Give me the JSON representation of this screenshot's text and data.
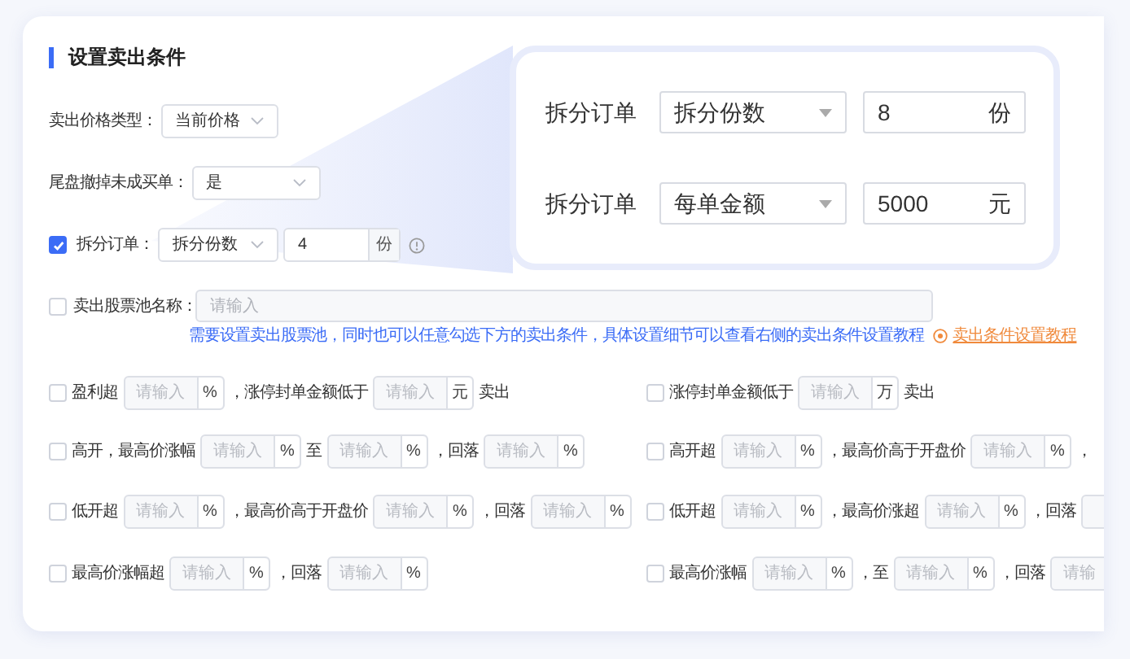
{
  "title": "设置卖出条件",
  "price_type": {
    "label": "卖出价格类型：",
    "value": "当前价格"
  },
  "cancel_unfilled": {
    "label": "尾盘撤掉未成买单：",
    "value": "是"
  },
  "split_order": {
    "checked": true,
    "label": "拆分订单：",
    "mode": "拆分份数",
    "value": "4",
    "unit": "份"
  },
  "stock_pool": {
    "checked": false,
    "label": "卖出股票池名称：",
    "placeholder": "请输入",
    "hint": "需要设置卖出股票池，同时也可以任意勾选下方的卖出条件，具体设置细节可以查看右侧的卖出条件设置教程",
    "link": "卖出条件设置教程"
  },
  "condition_rows": [
    {
      "left": {
        "checked": false,
        "parts": [
          {
            "kind": "text",
            "text": "盈利超"
          },
          {
            "kind": "input",
            "placeholder": "请输入",
            "unit": "%"
          },
          {
            "kind": "text",
            "text": "，涨停封单金额低于"
          },
          {
            "kind": "input",
            "placeholder": "请输入",
            "unit": "元"
          },
          {
            "kind": "text",
            "text": "卖出"
          }
        ]
      },
      "right": {
        "checked": false,
        "parts": [
          {
            "kind": "text",
            "text": "涨停封单金额低于"
          },
          {
            "kind": "input",
            "placeholder": "请输入",
            "unit": "万"
          },
          {
            "kind": "text",
            "text": "卖出"
          }
        ]
      }
    },
    {
      "left": {
        "checked": false,
        "parts": [
          {
            "kind": "text",
            "text": "高开，最高价涨幅"
          },
          {
            "kind": "input",
            "placeholder": "请输入",
            "unit": "%"
          },
          {
            "kind": "text",
            "text": "至"
          },
          {
            "kind": "input",
            "placeholder": "请输入",
            "unit": "%"
          },
          {
            "kind": "text",
            "text": "，回落"
          },
          {
            "kind": "input",
            "placeholder": "请输入",
            "unit": "%"
          }
        ]
      },
      "right": {
        "checked": false,
        "parts": [
          {
            "kind": "text",
            "text": "高开超"
          },
          {
            "kind": "input",
            "placeholder": "请输入",
            "unit": "%"
          },
          {
            "kind": "text",
            "text": "，最高价高于开盘价"
          },
          {
            "kind": "input",
            "placeholder": "请输入",
            "unit": "%"
          },
          {
            "kind": "text",
            "text": "，"
          }
        ]
      }
    },
    {
      "left": {
        "checked": false,
        "parts": [
          {
            "kind": "text",
            "text": "低开超"
          },
          {
            "kind": "input",
            "placeholder": "请输入",
            "unit": "%"
          },
          {
            "kind": "text",
            "text": "，最高价高于开盘价"
          },
          {
            "kind": "input",
            "placeholder": "请输入",
            "unit": "%"
          },
          {
            "kind": "text",
            "text": "，回落"
          },
          {
            "kind": "input",
            "placeholder": "请输入",
            "unit": "%"
          }
        ]
      },
      "right": {
        "checked": false,
        "parts": [
          {
            "kind": "text",
            "text": "低开超"
          },
          {
            "kind": "input",
            "placeholder": "请输入",
            "unit": "%"
          },
          {
            "kind": "text",
            "text": "，最高价涨超"
          },
          {
            "kind": "input",
            "placeholder": "请输入",
            "unit": "%"
          },
          {
            "kind": "text",
            "text": "，回落"
          },
          {
            "kind": "input"
          }
        ]
      }
    },
    {
      "left": {
        "checked": false,
        "parts": [
          {
            "kind": "text",
            "text": "最高价涨幅超"
          },
          {
            "kind": "input",
            "placeholder": "请输入",
            "unit": "%"
          },
          {
            "kind": "text",
            "text": "，回落"
          },
          {
            "kind": "input",
            "placeholder": "请输入",
            "unit": "%"
          }
        ]
      },
      "right": {
        "checked": false,
        "parts": [
          {
            "kind": "text",
            "text": "最高价涨幅"
          },
          {
            "kind": "input",
            "placeholder": "请输入",
            "unit": "%"
          },
          {
            "kind": "text",
            "text": "，至"
          },
          {
            "kind": "input",
            "placeholder": "请输入",
            "unit": "%"
          },
          {
            "kind": "text",
            "text": "，回落"
          },
          {
            "kind": "input",
            "placeholder": "请输"
          }
        ]
      }
    }
  ],
  "zoom_panel": {
    "rows": [
      {
        "label": "拆分订单",
        "mode": "拆分份数",
        "value": "8",
        "unit": "份"
      },
      {
        "label": "拆分订单",
        "mode": "每单金额",
        "value": "5000",
        "unit": "元"
      }
    ]
  }
}
